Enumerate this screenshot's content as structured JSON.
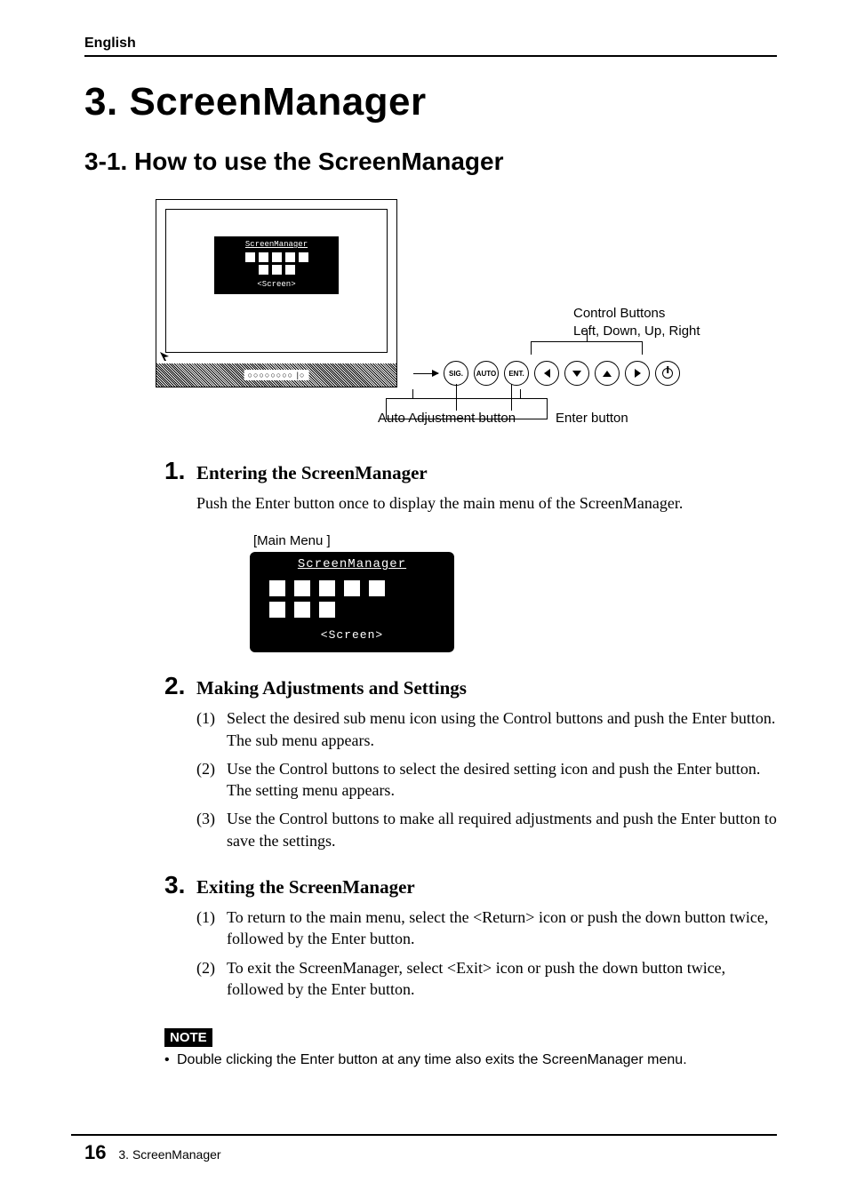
{
  "header": {
    "language": "English"
  },
  "chapter": {
    "number": "3.",
    "title": "ScreenManager"
  },
  "section": {
    "number": "3-1.",
    "title": "How to use the ScreenManager"
  },
  "figure": {
    "osd_title": "ScreenManager",
    "osd_selected": "<Screen>",
    "bezel_indicators": "○○○○○○○○ |○",
    "labels": {
      "control_buttons": "Control Buttons",
      "control_buttons_sub": "Left, Down, Up, Right",
      "auto_adj": "Auto Adjustment button",
      "enter": "Enter button"
    },
    "buttons": {
      "sig": "SIG.",
      "auto": "AUTO",
      "ent": "ENT."
    }
  },
  "steps": [
    {
      "num": "1.",
      "title": "Entering the ScreenManager",
      "desc": "Push the Enter button once to display the main menu of the ScreenManager."
    },
    {
      "num": "2.",
      "title": "Making Adjustments and Settings",
      "sublist": [
        {
          "marker": "(1)",
          "text": "Select the desired sub menu icon using the Control buttons and push the Enter button. The sub menu appears."
        },
        {
          "marker": "(2)",
          "text": "Use the Control buttons to select the desired setting icon and push the Enter button. The setting menu appears."
        },
        {
          "marker": "(3)",
          "text": "Use the Control buttons to make all required adjustments and push the Enter button to save the settings."
        }
      ]
    },
    {
      "num": "3.",
      "title": "Exiting the ScreenManager",
      "sublist": [
        {
          "marker": "(1)",
          "text": "To return to the main menu, select the <Return> icon or push the down button twice, followed by the Enter button."
        },
        {
          "marker": "(2)",
          "text": "To exit the ScreenManager, select <Exit> icon or push the down button twice, followed by the Enter button."
        }
      ]
    }
  ],
  "menu_preview": {
    "caption": "[Main Menu ]",
    "title": "ScreenManager",
    "selected": "<Screen>"
  },
  "note": {
    "label": "NOTE",
    "text": "Double clicking the Enter button at any time also exits the ScreenManager menu."
  },
  "footer": {
    "page": "16",
    "chapter_ref": "3. ScreenManager"
  }
}
